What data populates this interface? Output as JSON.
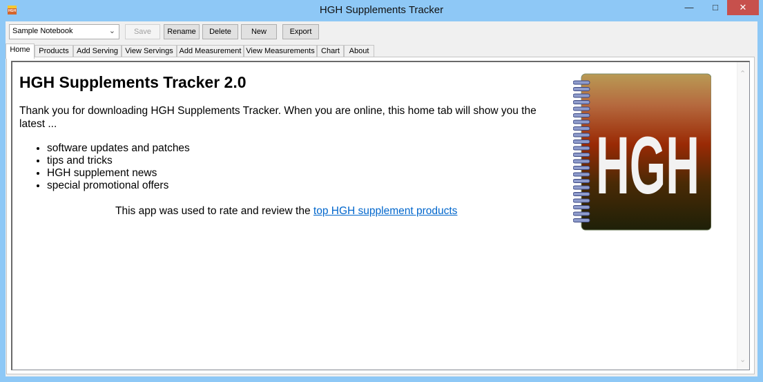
{
  "window": {
    "title": "HGH Supplements Tracker",
    "icon": "hgh-app-icon",
    "icon_text": "HGH",
    "controls": [
      "minimize",
      "maximize",
      "close"
    ]
  },
  "toolbar": {
    "notebook_select": "Sample Notebook",
    "save": "Save",
    "rename": "Rename",
    "delete": "Delete",
    "new": "New",
    "export": "Export"
  },
  "tabs": [
    "Home",
    "Products",
    "Add Serving",
    "View Servings",
    "Add Measurement",
    "View Measurements",
    "Chart",
    "About"
  ],
  "active_tab": "Home",
  "home": {
    "heading": "HGH Supplements Tracker 2.0",
    "intro": "Thank you for downloading HGH Supplements Tracker. When you are online, this home tab will show you the latest ...",
    "bullets": [
      "software updates and patches",
      "tips and tricks",
      "HGH supplement news",
      "special promotional offers"
    ],
    "promo_text": "This app was used to rate and review the ",
    "promo_link": "top HGH supplement products",
    "logo_text": "HGH"
  }
}
